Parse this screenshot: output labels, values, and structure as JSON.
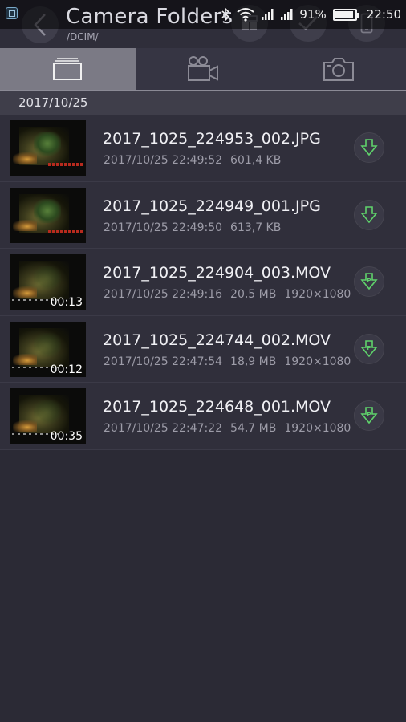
{
  "status_bar": {
    "battery_percent": "91%",
    "battery_level": 0.91,
    "time": "22:50",
    "icons": [
      "notification-icon",
      "bluetooth-icon",
      "wifi-icon",
      "signal-icon",
      "signal-icon",
      "battery-icon"
    ]
  },
  "header": {
    "title": "Camera Folders",
    "path": "/DCIM/",
    "buttons": [
      "back-icon",
      "grid-icon",
      "checkmark-icon",
      "phone-icon"
    ]
  },
  "tabs": [
    {
      "name": "folders",
      "icon": "folder-icon",
      "active": true
    },
    {
      "name": "videos",
      "icon": "video-camera-icon",
      "active": false
    },
    {
      "name": "photos",
      "icon": "camera-icon",
      "active": false
    }
  ],
  "section": {
    "date": "2017/10/25"
  },
  "files": [
    {
      "name": "2017_1025_224953_002.JPG",
      "datetime": "2017/10/25 22:49:52",
      "size": "601,4 KB",
      "resolution": "",
      "duration": "",
      "type": "photo",
      "action_icon": "download-icon"
    },
    {
      "name": "2017_1025_224949_001.JPG",
      "datetime": "2017/10/25 22:49:50",
      "size": "613,7 KB",
      "resolution": "",
      "duration": "",
      "type": "photo",
      "action_icon": "download-icon"
    },
    {
      "name": "2017_1025_224904_003.MOV",
      "datetime": "2017/10/25 22:49:16",
      "size": "20,5 MB",
      "resolution": "1920×1080",
      "duration": "00:13",
      "type": "video",
      "action_icon": "download-play-icon"
    },
    {
      "name": "2017_1025_224744_002.MOV",
      "datetime": "2017/10/25 22:47:54",
      "size": "18,9 MB",
      "resolution": "1920×1080",
      "duration": "00:12",
      "type": "video",
      "action_icon": "download-play-icon"
    },
    {
      "name": "2017_1025_224648_001.MOV",
      "datetime": "2017/10/25 22:47:22",
      "size": "54,7 MB",
      "resolution": "1920×1080",
      "duration": "00:35",
      "type": "video",
      "action_icon": "download-play-icon"
    }
  ],
  "colors": {
    "background": "#2b2a35",
    "accent_green": "#5fd36b",
    "active_tab": "#7b7a85"
  }
}
